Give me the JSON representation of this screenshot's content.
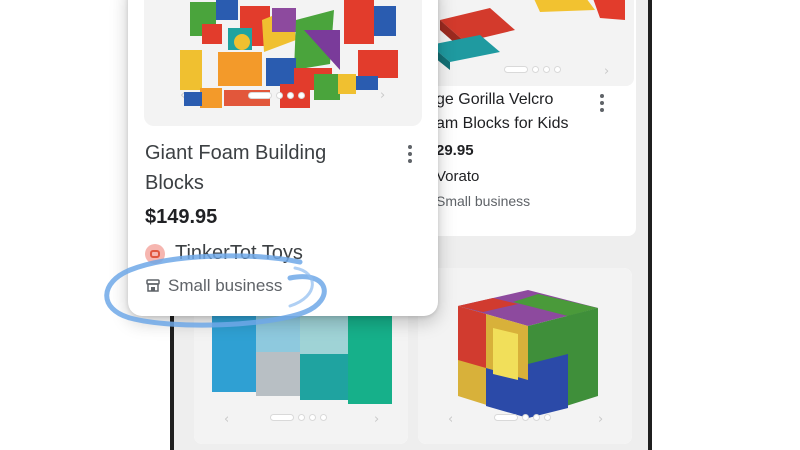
{
  "products": [
    {
      "title": "Giant Foam Building Blocks",
      "price": "$149.95",
      "seller": "TinkerTot Toys",
      "badge": "Small business",
      "icon": "storefront-icon",
      "highlighted": true
    },
    {
      "title_line1": "ge Gorilla Velcro",
      "title_line2": "am Blocks for Kids",
      "price": "29.95",
      "seller": "Vorato",
      "badge": "Small business"
    }
  ],
  "colors": {
    "highlight_ring": "#6fa8e8",
    "price_text": "#202124",
    "badge_text": "#5f6368"
  }
}
